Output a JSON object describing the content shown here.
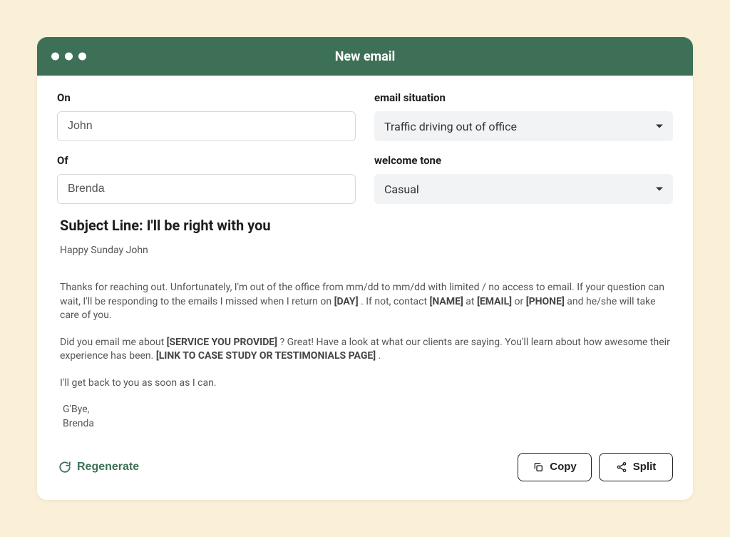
{
  "window": {
    "title": "New email"
  },
  "form": {
    "on_label": "On",
    "on_value": "John",
    "of_label": "Of",
    "of_value": "Brenda",
    "situation_label": "email situation",
    "situation_value": "Traffic driving out of office",
    "tone_label": "welcome tone",
    "tone_value": "Casual"
  },
  "subject": "Subject Line: I'll be right with you",
  "body": {
    "greeting": "Happy Sunday John",
    "p1_pre": "Thanks for reaching out. Unfortunately, I'm out of the office from mm/dd to mm/dd with limited / no access to email. If your question can wait, I'll be responding to the emails I missed when I return on ",
    "p1_b1": "[DAY]",
    "p1_mid1": " . If not, contact ",
    "p1_b2": "[NAME]",
    "p1_mid2": " at ",
    "p1_b3": "[EMAIL]",
    "p1_mid3": " or ",
    "p1_b4": "[PHONE]",
    "p1_post": " and he/she will take care of you.",
    "p2_pre": "Did you email me about ",
    "p2_b1": "[SERVICE YOU PROVIDE]",
    "p2_mid": " ? Great! Have a look at what our clients are saying. You'll learn about how awesome their experience has been. ",
    "p2_b2": "[LINK TO CASE STUDY OR TESTIMONIALS PAGE]",
    "p2_post": " .",
    "p3": "I'll get back to you as soon as I can.",
    "signoff1": "G'Bye,",
    "signoff2": "Brenda"
  },
  "actions": {
    "regenerate": "Regenerate",
    "copy": "Copy",
    "split": "Split"
  }
}
